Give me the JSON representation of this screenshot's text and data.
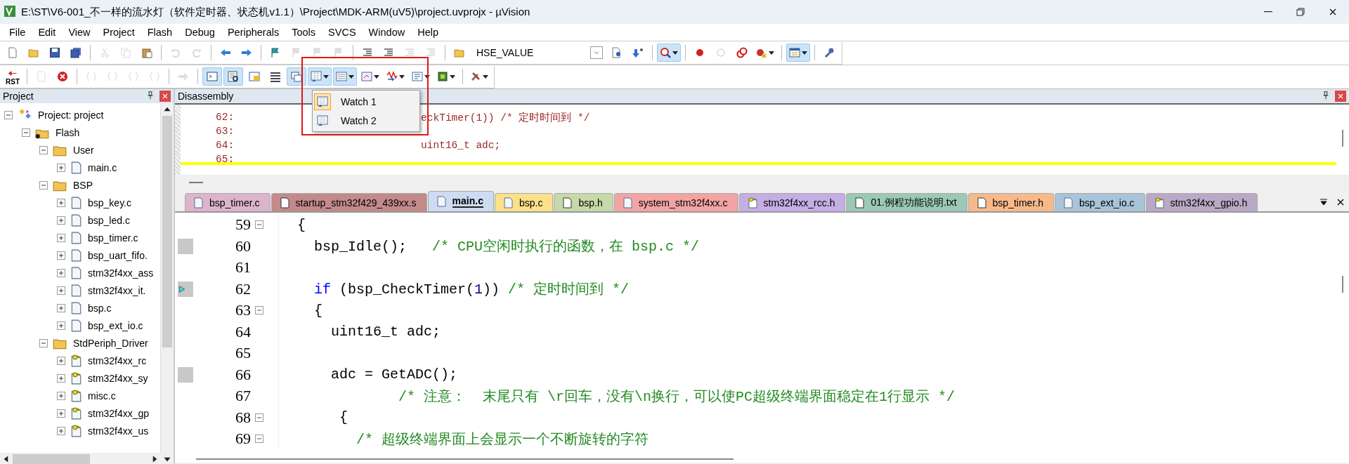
{
  "window": {
    "title": "E:\\ST\\V6-001_不一样的流水灯（软件定时器、状态机v1.1）\\Project\\MDK-ARM(uV5)\\project.uvprojx - µVision"
  },
  "menu": [
    "File",
    "Edit",
    "View",
    "Project",
    "Flash",
    "Debug",
    "Peripherals",
    "Tools",
    "SVCS",
    "Window",
    "Help"
  ],
  "toolbars": [
    {
      "items": [
        {
          "kind": "button",
          "on": false,
          "disabled": false
        },
        {
          "kind": "button",
          "on": false,
          "disabled": false
        },
        {
          "kind": "button",
          "on": false,
          "disabled": false
        },
        {
          "kind": "button",
          "on": false,
          "disabled": false
        },
        {
          "kind": "separator"
        },
        {
          "kind": "button",
          "on": false,
          "disabled": true
        },
        {
          "kind": "button",
          "on": false,
          "disabled": true
        },
        {
          "kind": "button",
          "on": false,
          "disabled": false
        },
        {
          "kind": "separator"
        },
        {
          "kind": "button",
          "on": false,
          "disabled": true
        },
        {
          "kind": "button",
          "on": false,
          "disabled": true
        },
        {
          "kind": "separator"
        },
        {
          "kind": "button",
          "on": false,
          "disabled": false
        },
        {
          "kind": "button",
          "on": false,
          "disabled": false
        },
        {
          "kind": "separator"
        },
        {
          "kind": "button",
          "on": false,
          "disabled": false
        },
        {
          "kind": "button",
          "on": false,
          "disabled": true
        },
        {
          "kind": "button",
          "on": false,
          "disabled": true
        },
        {
          "kind": "button",
          "on": false,
          "disabled": true
        },
        {
          "kind": "separator"
        },
        {
          "kind": "button",
          "on": false,
          "disabled": false
        },
        {
          "kind": "button",
          "on": false,
          "disabled": false
        },
        {
          "kind": "button",
          "on": false,
          "disabled": true
        },
        {
          "kind": "button",
          "on": false,
          "disabled": true
        },
        {
          "kind": "separator"
        },
        {
          "kind": "button",
          "on": false,
          "disabled": false
        },
        {
          "kind": "combo",
          "value": "HSE_VALUE"
        },
        {
          "kind": "button",
          "on": false,
          "disabled": false
        },
        {
          "kind": "button",
          "on": false,
          "disabled": false
        },
        {
          "kind": "separator"
        },
        {
          "kind": "split",
          "on": true,
          "disabled": false
        },
        {
          "kind": "separator"
        },
        {
          "kind": "button",
          "on": false,
          "disabled": false
        },
        {
          "kind": "button",
          "on": false,
          "disabled": true
        },
        {
          "kind": "button",
          "on": false,
          "disabled": false
        },
        {
          "kind": "split",
          "on": false,
          "disabled": false
        },
        {
          "kind": "separator"
        },
        {
          "kind": "split",
          "on": true,
          "disabled": false
        },
        {
          "kind": "separator"
        },
        {
          "kind": "button",
          "on": false,
          "disabled": false
        }
      ]
    },
    {
      "items": [
        {
          "kind": "labeled",
          "label": "RST",
          "on": false,
          "disabled": false
        },
        {
          "kind": "separator"
        },
        {
          "kind": "button",
          "on": false,
          "disabled": true
        },
        {
          "kind": "button",
          "on": false,
          "disabled": false
        },
        {
          "kind": "separator"
        },
        {
          "kind": "button",
          "on": false,
          "disabled": true
        },
        {
          "kind": "button",
          "on": false,
          "disabled": true
        },
        {
          "kind": "button",
          "on": false,
          "disabled": true
        },
        {
          "kind": "button",
          "on": false,
          "disabled": true
        },
        {
          "kind": "separator"
        },
        {
          "kind": "button",
          "on": false,
          "disabled": true
        },
        {
          "kind": "separator"
        },
        {
          "kind": "button",
          "on": true,
          "disabled": false
        },
        {
          "kind": "button",
          "on": true,
          "disabled": false
        },
        {
          "kind": "button",
          "on": false,
          "disabled": false
        },
        {
          "kind": "button",
          "on": false,
          "disabled": false
        },
        {
          "kind": "button",
          "on": true,
          "disabled": false
        },
        {
          "kind": "split",
          "on": true,
          "disabled": false
        },
        {
          "kind": "split",
          "on": true,
          "disabled": false
        },
        {
          "kind": "split",
          "on": false,
          "disabled": false
        },
        {
          "kind": "split",
          "on": false,
          "disabled": false
        },
        {
          "kind": "split",
          "on": false,
          "disabled": false
        },
        {
          "kind": "split",
          "on": false,
          "disabled": false
        },
        {
          "kind": "separator"
        },
        {
          "kind": "split",
          "on": false,
          "disabled": false
        }
      ]
    }
  ],
  "watch_menu": {
    "items": [
      {
        "label": "Watch 1",
        "selected": true
      },
      {
        "label": "Watch 2",
        "selected": false
      }
    ]
  },
  "project_panel": {
    "title": "Project",
    "tree": [
      {
        "label": "Project: project",
        "kind": "project",
        "expanded": true,
        "children": [
          {
            "label": "Flash",
            "kind": "target",
            "expanded": true,
            "children": [
              {
                "label": "User",
                "kind": "group",
                "expanded": true,
                "children": [
                  {
                    "label": "main.c",
                    "kind": "file",
                    "expanded": false
                  }
                ]
              },
              {
                "label": "BSP",
                "kind": "group",
                "expanded": true,
                "children": [
                  {
                    "label": "bsp_key.c",
                    "kind": "file",
                    "expanded": false
                  },
                  {
                    "label": "bsp_led.c",
                    "kind": "file",
                    "expanded": false
                  },
                  {
                    "label": "bsp_timer.c",
                    "kind": "file",
                    "expanded": false
                  },
                  {
                    "label": "bsp_uart_fifo.",
                    "kind": "file",
                    "expanded": false
                  },
                  {
                    "label": "stm32f4xx_ass",
                    "kind": "file",
                    "expanded": false
                  },
                  {
                    "label": "stm32f4xx_it.",
                    "kind": "file",
                    "expanded": false
                  },
                  {
                    "label": "bsp.c",
                    "kind": "file",
                    "expanded": false
                  },
                  {
                    "label": "bsp_ext_io.c",
                    "kind": "file",
                    "expanded": false
                  }
                ]
              },
              {
                "label": "StdPeriph_Driver",
                "kind": "group",
                "expanded": true,
                "children": [
                  {
                    "label": "stm32f4xx_rc",
                    "kind": "key-file",
                    "expanded": false
                  },
                  {
                    "label": "stm32f4xx_sy",
                    "kind": "key-file",
                    "expanded": false
                  },
                  {
                    "label": "misc.c",
                    "kind": "key-file",
                    "expanded": false
                  },
                  {
                    "label": "stm32f4xx_gp",
                    "kind": "key-file",
                    "expanded": false
                  },
                  {
                    "label": "stm32f4xx_us",
                    "kind": "key-file",
                    "expanded": false
                  }
                ]
              }
            ]
          }
        ]
      }
    ]
  },
  "disassembly": {
    "title": "Disassembly",
    "lines": [
      {
        "address": "62:",
        "text": "eckTimer(1)) /* 定时时间到 */",
        "current": false
      },
      {
        "address": "63:",
        "current": false
      },
      {
        "address": "64:",
        "text": "uint16_t adc;",
        "current": false
      },
      {
        "address": "65:",
        "current": true
      }
    ]
  },
  "tabs": [
    {
      "label": "bsp_timer.c",
      "kind": "file",
      "color": "#dcb4cc",
      "selected": false
    },
    {
      "label": "startup_stm32f429_439xx.s",
      "kind": "plain-file",
      "color": "#c48a8a",
      "selected": false
    },
    {
      "label": "main.c",
      "kind": "file",
      "color": "#cddcf2",
      "selected": true
    },
    {
      "label": "bsp.c",
      "kind": "file",
      "color": "#fde08a",
      "selected": false
    },
    {
      "label": "bsp.h",
      "kind": "plain-file",
      "color": "#c6d9a8",
      "selected": false
    },
    {
      "label": "system_stm32f4xx.c",
      "kind": "file",
      "color": "#f2a4a4",
      "selected": false
    },
    {
      "label": "stm32f4xx_rcc.h",
      "kind": "key-file",
      "color": "#c4aee4",
      "selected": false
    },
    {
      "label": "01.例程功能说明.txt",
      "kind": "plain-file",
      "color": "#9cc8b6",
      "selected": false
    },
    {
      "label": "bsp_timer.h",
      "kind": "plain-file",
      "color": "#f8b98a",
      "selected": false
    },
    {
      "label": "bsp_ext_io.c",
      "kind": "file",
      "color": "#a9c4d8",
      "selected": false
    },
    {
      "label": "stm32f4xx_gpio.h",
      "kind": "key-file",
      "color": "#b9a9c6",
      "selected": false
    }
  ],
  "editor": {
    "lines": [
      {
        "number": "59",
        "fold": true,
        "executable": false,
        "current": false,
        "segments": [
          {
            "kind": "plain",
            "text": " {"
          }
        ]
      },
      {
        "number": "60",
        "fold": false,
        "executable": true,
        "current": false,
        "segments": [
          {
            "kind": "plain",
            "text": "   bsp_Idle();   "
          },
          {
            "kind": "comment",
            "text": "/* CPU空闲时执行的函数，在 bsp.c */"
          }
        ]
      },
      {
        "number": "61",
        "fold": false,
        "executable": false,
        "current": false
      },
      {
        "number": "62",
        "fold": false,
        "executable": true,
        "current": true,
        "segments": [
          {
            "kind": "keyword",
            "text": "   if"
          },
          {
            "kind": "plain",
            "text": " (bsp_CheckTimer("
          },
          {
            "kind": "number",
            "text": "1"
          },
          {
            "kind": "plain",
            "text": ")) "
          },
          {
            "kind": "comment",
            "text": "/* 定时时间到 */"
          }
        ]
      },
      {
        "number": "63",
        "fold": true,
        "executable": false,
        "current": false,
        "segments": [
          {
            "kind": "plain",
            "text": "   {"
          }
        ]
      },
      {
        "number": "64",
        "fold": false,
        "executable": false,
        "current": false,
        "segments": [
          {
            "kind": "plain",
            "text": "     uint16_t adc;"
          }
        ]
      },
      {
        "number": "65",
        "fold": false,
        "executable": false,
        "current": false
      },
      {
        "number": "66",
        "fold": false,
        "executable": true,
        "current": false,
        "segments": [
          {
            "kind": "plain",
            "text": "     adc = GetADC();"
          }
        ]
      },
      {
        "number": "67",
        "fold": false,
        "executable": false,
        "current": false,
        "segments": [
          {
            "kind": "comment",
            "text": "             /* 注意：  末尾只有 \\r回车，没有\\n换行，可以使PC超级终端界面稳定在1行显示 */"
          }
        ]
      },
      {
        "number": "68",
        "fold": true,
        "executable": false,
        "current": false,
        "segments": [
          {
            "kind": "plain",
            "text": "      {"
          }
        ]
      },
      {
        "number": "69",
        "fold": true,
        "executable": false,
        "current": false,
        "segments": [
          {
            "kind": "comment",
            "text": "        /* 超级终端界面上会显示一个不断旋转的字符"
          }
        ]
      }
    ]
  }
}
